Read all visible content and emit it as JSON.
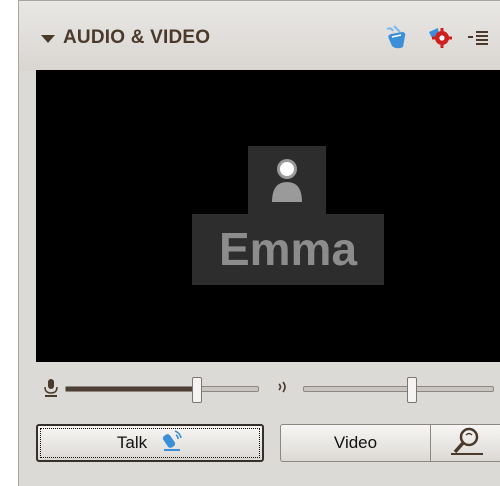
{
  "panel": {
    "title": "AUDIO & VIDEO",
    "icons": {
      "collapse": "collapse-arrow-icon",
      "hand_raise": "hand-raise-icon",
      "settings": "settings-gear-icon",
      "menu": "options-menu-icon"
    }
  },
  "video": {
    "participant_name": "Emma",
    "placeholder_icon": "person-silhouette-icon"
  },
  "controls": {
    "mic_icon": "microphone-icon",
    "mic_level": 0.68,
    "speaker_icon": "speaker-icon",
    "speaker_level": 0.57,
    "talk_label": "Talk",
    "talk_icon": "microphone-talk-icon",
    "video_label": "Video",
    "search_icon": "find-participant-icon"
  },
  "colors": {
    "title": "#4b3a2c",
    "video_bg": "#000000",
    "name_plate": "#2d2d2d",
    "name_text": "#8c8c8c",
    "accent_blue": "#3b8fd8",
    "settings_red": "#d01f1f"
  }
}
